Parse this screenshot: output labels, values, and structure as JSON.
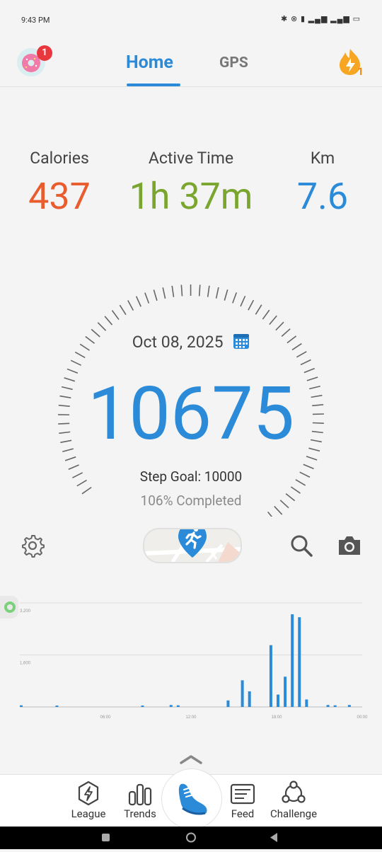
{
  "status_bar": {
    "time": "9:43 PM",
    "icons_text": "✱ ⊗ ▮ ▂▄▆ ▂▄▆ ▭"
  },
  "header": {
    "badge_count": "1",
    "tabs": [
      {
        "label": "Home"
      },
      {
        "label": "GPS"
      }
    ],
    "streak_count": "1"
  },
  "stats": [
    {
      "label": "Calories",
      "value": "437",
      "color": "#e85c2e"
    },
    {
      "label": "Active Time",
      "value": "1h 37m",
      "color": "#7aa630"
    },
    {
      "label": "Km",
      "value": "7.6",
      "color": "#2b8bd9"
    }
  ],
  "gauge": {
    "date": "Oct 08, 2025",
    "steps": "10675",
    "goal_text": "Step Goal: 10000",
    "completed_text": "106% Completed",
    "progress_fraction": 1.0
  },
  "chart_data": {
    "type": "bar",
    "y_ticks": [
      "3,200",
      "1,600"
    ],
    "x_ticks": [
      "06:00",
      "12:00",
      "18:00",
      "00:00"
    ],
    "ylim": [
      0,
      3200
    ],
    "bars": [
      {
        "x": 0.1,
        "y": 50
      },
      {
        "x": 2.6,
        "y": 40
      },
      {
        "x": 8.6,
        "y": 40
      },
      {
        "x": 10.6,
        "y": 60
      },
      {
        "x": 11.1,
        "y": 50
      },
      {
        "x": 14.6,
        "y": 200
      },
      {
        "x": 15.6,
        "y": 820
      },
      {
        "x": 16.1,
        "y": 480
      },
      {
        "x": 17.6,
        "y": 1900
      },
      {
        "x": 18.1,
        "y": 380
      },
      {
        "x": 18.6,
        "y": 930
      },
      {
        "x": 19.1,
        "y": 2850
      },
      {
        "x": 19.6,
        "y": 2760
      },
      {
        "x": 20.1,
        "y": 230
      },
      {
        "x": 21.6,
        "y": 60
      },
      {
        "x": 22.1,
        "y": 50
      },
      {
        "x": 23.1,
        "y": 60
      }
    ]
  },
  "nav": [
    {
      "label": "League",
      "icon": "lightning-badge-icon"
    },
    {
      "label": "Trends",
      "icon": "bar-chart-icon"
    },
    {
      "label": "",
      "icon": "shoe-icon"
    },
    {
      "label": "Feed",
      "icon": "feed-card-icon"
    },
    {
      "label": "Challenge",
      "icon": "network-icon"
    }
  ]
}
